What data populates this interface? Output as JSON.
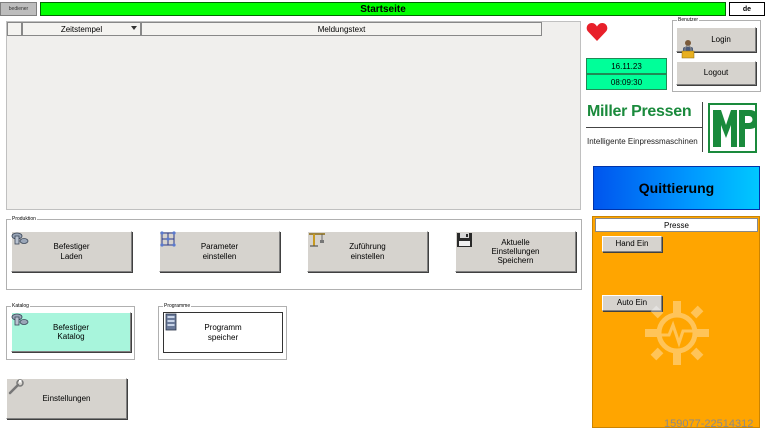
{
  "header": {
    "user_label": "bediener",
    "title": "Startseite",
    "language": "de"
  },
  "messages": {
    "columns": [
      "Zeitstempel",
      "Meldungstext"
    ]
  },
  "clock": {
    "date": "16.11.23",
    "time": "08:09:30"
  },
  "user": {
    "group_label": "Benutzer",
    "login": "Login",
    "logout": "Logout"
  },
  "logo": {
    "brand": "Miller Pressen",
    "tagline": "Intelligente Einpressmaschinen",
    "mark": "MP"
  },
  "quit_label": "Quittierung",
  "produktion": {
    "label": "Produktion",
    "buttons": [
      "Befestiger\nLaden",
      "Parameter\neinstellen",
      "Zuführung\neinstellen",
      "Aktuelle\nEinstellungen\nSpeichern"
    ]
  },
  "katalog": {
    "label": "Katalog",
    "button": "Befestiger\nKatalog"
  },
  "programme": {
    "label": "Programme",
    "button": "Programm\nspeicher"
  },
  "settings_label": "Einstellungen",
  "presse": {
    "title": "Presse",
    "hand": "Hand Ein",
    "auto": "Auto Ein"
  },
  "watermark": "159077-22514312",
  "colors": {
    "title_green": "#00ff00",
    "clock_green": "#00ff99",
    "presse_orange": "#ffa500",
    "katalog_mint": "#a8f5dc",
    "brand_green": "#1a8a3c"
  }
}
